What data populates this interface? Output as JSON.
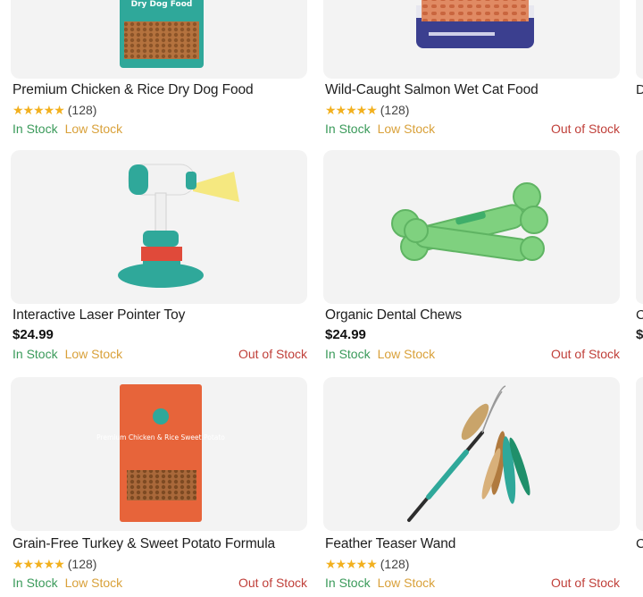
{
  "products": [
    {
      "id": "p1",
      "title": "Premium Chicken & Rice Dry Dog Food",
      "rating_stars": "★★★★★",
      "rating_count": "(128)",
      "price": null,
      "stock": {
        "in": "In Stock",
        "low": "Low Stock",
        "out": null
      },
      "image_label": "Dry Dog Food"
    },
    {
      "id": "p2",
      "title": "Wild-Caught Salmon Wet Cat Food",
      "rating_stars": "★★★★★",
      "rating_count": "(128)",
      "price": null,
      "stock": {
        "in": "In Stock",
        "low": "Low Stock",
        "out": "Out of Stock"
      }
    },
    {
      "id": "p3",
      "title": "Interactive Laser Pointer Toy",
      "rating_stars": null,
      "rating_count": null,
      "price": "$24.99",
      "stock": {
        "in": "In Stock",
        "low": "Low Stock",
        "out": "Out of Stock"
      }
    },
    {
      "id": "p4",
      "title": "Organic Dental Chews",
      "rating_stars": null,
      "rating_count": null,
      "price": "$24.99",
      "stock": {
        "in": "In Stock",
        "low": "Low Stock",
        "out": "Out of Stock"
      }
    },
    {
      "id": "p5",
      "title": "Grain-Free Turkey & Sweet Potato Formula",
      "rating_stars": "★★★★★",
      "rating_count": "(128)",
      "price": null,
      "stock": {
        "in": "In Stock",
        "low": "Low Stock",
        "out": "Out of Stock"
      },
      "image_label": "Premium Chicken & Rice Sweet Potato"
    },
    {
      "id": "p6",
      "title": "Feather Teaser Wand",
      "rating_stars": "★★★★★",
      "rating_count": "(128)",
      "price": null,
      "stock": {
        "in": "In Stock",
        "low": "Low Stock",
        "out": "Out of Stock"
      }
    }
  ],
  "peek_column": {
    "row1_initial": "D",
    "row2_initial": "C",
    "row2_price_initial": "$",
    "row3_initial": "C"
  },
  "colors": {
    "in_stock": "#3a9a5a",
    "low_stock": "#d9a13a",
    "out_of_stock": "#c0403a",
    "star": "#f2b01e",
    "tile_bg": "#f3f3f3"
  }
}
